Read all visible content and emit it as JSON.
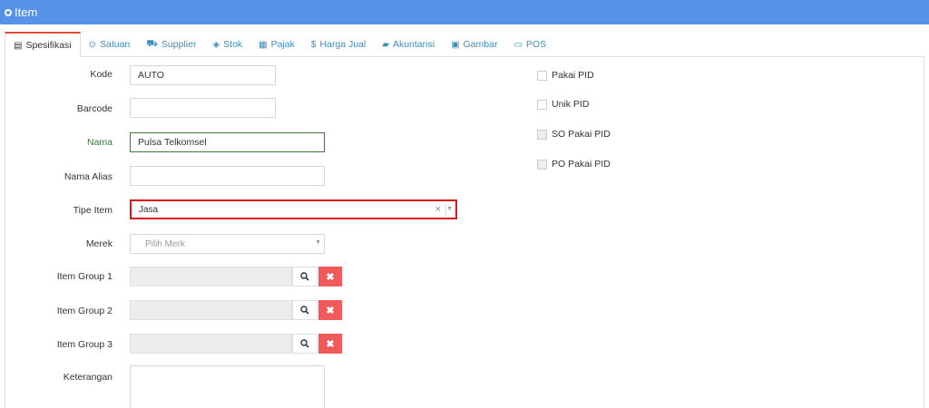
{
  "window": {
    "title": "Item"
  },
  "tabs": [
    {
      "label": "Spesifikasi",
      "icon": "▤"
    },
    {
      "label": "Satuan",
      "icon": "⊙"
    },
    {
      "label": "Supplier",
      "icon": "⛟"
    },
    {
      "label": "Stok",
      "icon": "◈"
    },
    {
      "label": "Pajak",
      "icon": "▦"
    },
    {
      "label": "Harga Jual",
      "icon": "$"
    },
    {
      "label": "Akuntansi",
      "icon": "▰"
    },
    {
      "label": "Gambar",
      "icon": "▣"
    },
    {
      "label": "POS",
      "icon": "▭"
    }
  ],
  "form": {
    "kode": {
      "label": "Kode",
      "value": "AUTO"
    },
    "barcode": {
      "label": "Barcode",
      "value": ""
    },
    "nama": {
      "label": "Nama",
      "value": "Pulsa Telkomsel"
    },
    "nama_alias": {
      "label": "Nama Alias",
      "value": ""
    },
    "tipe_item": {
      "label": "Tipe Item",
      "value": "Jasa",
      "clear": "×",
      "caret": "▼"
    },
    "merek": {
      "label": "Merek",
      "placeholder": "Pilih Merk",
      "caret": "▼"
    },
    "item_group_1": {
      "label": "Item Group 1",
      "value": "",
      "delete": "✖"
    },
    "item_group_2": {
      "label": "Item Group 2",
      "value": "",
      "delete": "✖"
    },
    "item_group_3": {
      "label": "Item Group 3",
      "value": "",
      "delete": "✖"
    },
    "keterangan": {
      "label": "Keterangan",
      "value": ""
    }
  },
  "options": {
    "pakai_pid": {
      "label": "Pakai PID",
      "checked": false
    },
    "unik_pid": {
      "label": "Unik PID",
      "checked": false
    },
    "so_pakai_pid": {
      "label": "SO Pakai PID",
      "checked": false
    },
    "po_pakai_pid": {
      "label": "PO Pakai PID",
      "checked": false
    }
  },
  "colors": {
    "header": "#5592e8",
    "link": "#3c8dbc",
    "highlight": "#e0141b",
    "delete": "#f05a5a",
    "valid": "#3c763d"
  }
}
